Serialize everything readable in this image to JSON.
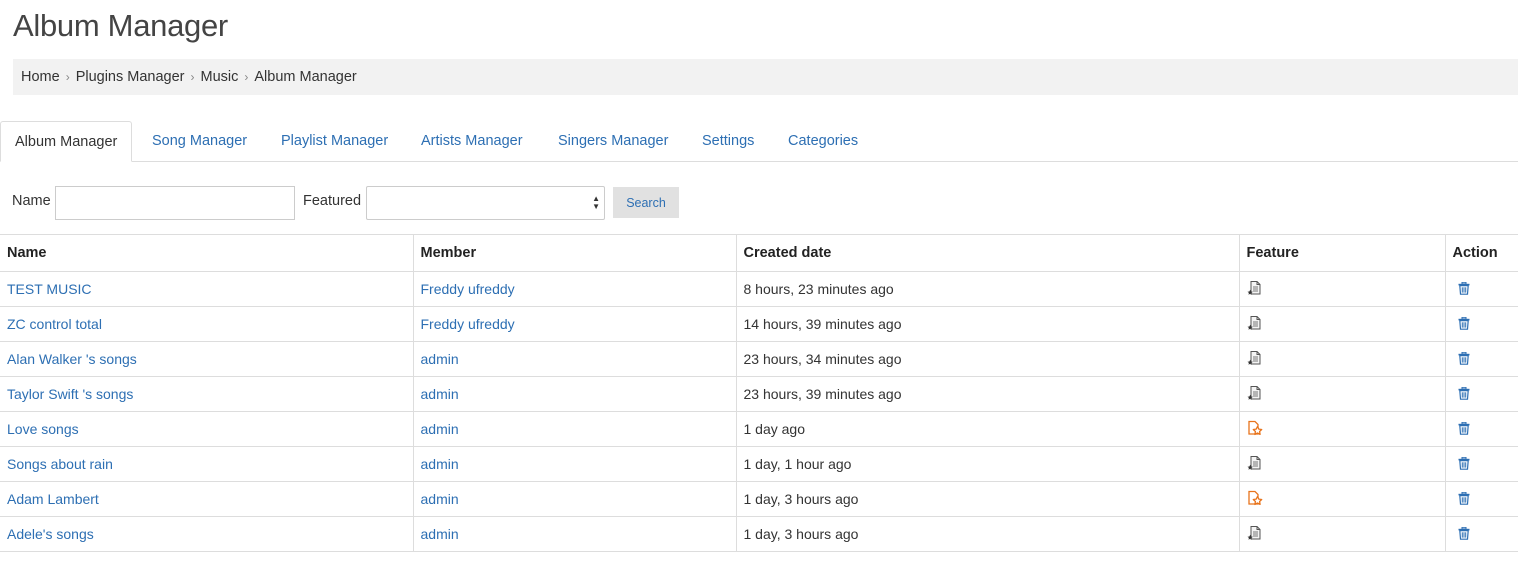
{
  "page": {
    "title": "Album Manager"
  },
  "breadcrumb": [
    "Home",
    "Plugins Manager",
    "Music",
    "Album Manager"
  ],
  "tabs": [
    "Album Manager",
    "Song Manager",
    "Playlist Manager",
    "Artists Manager",
    "Singers Manager",
    "Settings",
    "Categories"
  ],
  "filters": {
    "name_label": "Name",
    "name_value": "",
    "featured_label": "Featured",
    "featured_value": "",
    "search_label": "Search"
  },
  "table": {
    "headers": [
      "Name",
      "Member",
      "Created date",
      "Feature",
      "Action"
    ],
    "rows": [
      {
        "name": "TEST MUSIC",
        "member": "Freddy ufreddy",
        "created": "8 hours, 23 minutes ago",
        "featured": false
      },
      {
        "name": "ZC control total",
        "member": "Freddy ufreddy",
        "created": "14 hours, 39 minutes ago",
        "featured": false
      },
      {
        "name": "Alan Walker 's songs",
        "member": "admin",
        "created": "23 hours, 34 minutes ago",
        "featured": false
      },
      {
        "name": "Taylor Swift 's songs",
        "member": "admin",
        "created": "23 hours, 39 minutes ago",
        "featured": false
      },
      {
        "name": "Love songs",
        "member": "admin",
        "created": "1 day ago",
        "featured": true
      },
      {
        "name": "Songs about rain",
        "member": "admin",
        "created": "1 day, 1 hour ago",
        "featured": false
      },
      {
        "name": "Adam Lambert",
        "member": "admin",
        "created": "1 day, 3 hours ago",
        "featured": true
      },
      {
        "name": "Adele's songs",
        "member": "admin",
        "created": "1 day, 3 hours ago",
        "featured": false
      }
    ]
  },
  "icons": {
    "feature_off": "unfeatured-icon",
    "feature_on": "featured-star-icon",
    "delete": "trash-icon"
  },
  "colors": {
    "link": "#2d6fb3",
    "featured": "#e8741c",
    "breadcrumb_bg": "#f2f2f2",
    "border": "#dddddd"
  }
}
